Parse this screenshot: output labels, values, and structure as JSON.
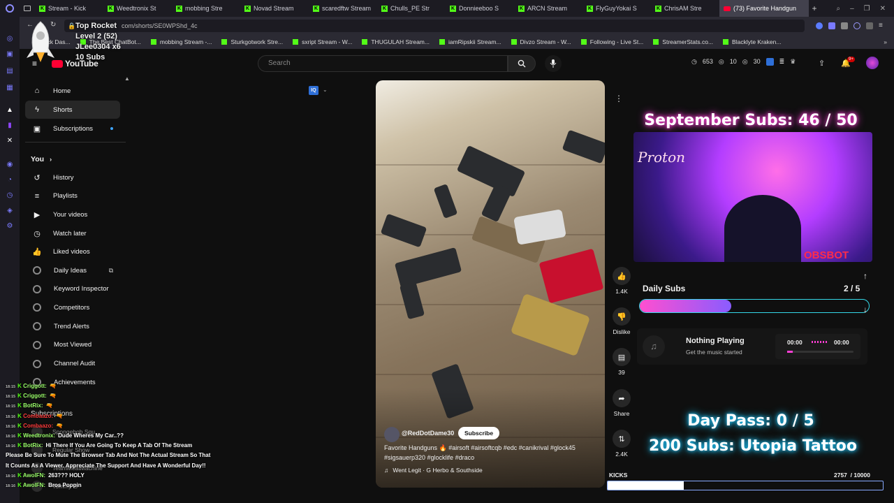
{
  "tabs": [
    {
      "label": "Stream - Kick",
      "kind": "kick"
    },
    {
      "label": "Weedtronix St",
      "kind": "kick"
    },
    {
      "label": "mobbing Stre",
      "kind": "kick"
    },
    {
      "label": "Novad Stream",
      "kind": "kick"
    },
    {
      "label": "scaredftw Stream",
      "kind": "kick"
    },
    {
      "label": "Chulls_PE Str",
      "kind": "kick"
    },
    {
      "label": "Donnieeboo S",
      "kind": "kick"
    },
    {
      "label": "ARCN Stream",
      "kind": "kick"
    },
    {
      "label": "FlyGuyYokai S",
      "kind": "kick"
    },
    {
      "label": "ChrisAM Stre",
      "kind": "kick"
    },
    {
      "label": "(73) Favorite Handgun",
      "kind": "youtube"
    }
  ],
  "address": {
    "url": "com/shorts/SE0WPShd_4c"
  },
  "bookmarks": [
    "Kick Das...",
    "The Best ChatBot...",
    "mobbing Stream -...",
    "Sturkgotwork Stre...",
    "sxript Stream - W...",
    "THUGULAH Stream...",
    "iamRipskii Stream...",
    "Divzo Stream - W...",
    "Following - Live St...",
    "StreamerStats.co...",
    "Blacklyte Kraken..."
  ],
  "rocket_overlay": {
    "title": "Top Rocket",
    "level": "Level 2 (52)",
    "user": "JLee0304 x6",
    "subs": "10 Subs"
  },
  "youtube": {
    "logo": "YouTube",
    "search_placeholder": "Search"
  },
  "sidebar": {
    "main": [
      {
        "label": "Home",
        "icon": "home-icon"
      },
      {
        "label": "Shorts",
        "icon": "shorts-icon"
      },
      {
        "label": "Subscriptions",
        "icon": "subscriptions-icon"
      }
    ],
    "you_label": "You",
    "you": [
      {
        "label": "History",
        "icon": "history-icon"
      },
      {
        "label": "Playlists",
        "icon": "playlists-icon"
      },
      {
        "label": "Your videos",
        "icon": "your-videos-icon"
      },
      {
        "label": "Watch later",
        "icon": "watch-later-icon"
      },
      {
        "label": "Liked videos",
        "icon": "liked-videos-icon"
      }
    ],
    "extensions": [
      "Daily Ideas",
      "Keyword Inspector",
      "Competitors",
      "Trend Alerts",
      "Most Viewed",
      "Channel Audit",
      "Achievements"
    ],
    "subscriptions_label": "Subscriptions",
    "subscriptions": [
      "Spongebob Squ...",
      "Regular Show",
      "TeamMeatMachine",
      "Tommy G"
    ]
  },
  "header_stats": {
    "views": "653",
    "likes": "10",
    "comments": "30"
  },
  "video": {
    "channel": "@RedDotDame30",
    "subscribe": "Subscribe",
    "caption_line1": "Favorite Handguns 🔥 #airsoft #airsoftcqb #edc #canikrival #glock45",
    "caption_line2": "#sigsauerp320 #glocklife #draco",
    "music": "Went Legit · G Herbo & Southside"
  },
  "actions": {
    "likes": "1.4K",
    "dislike": "Dislike",
    "comments": "39",
    "share": "Share",
    "remix": "2.4K"
  },
  "overlay": {
    "sept_subs": "September Subs: 46 / 50",
    "cam_logo": "OBSBOT",
    "cam_name": "Proton",
    "daily_subs_label": "Daily Subs",
    "daily_subs_value": "2 / 5",
    "daily_subs_progress": 0.4,
    "music_title": "Nothing Playing",
    "music_sub": "Get the music started",
    "music_time_start": "00:00",
    "music_time_end": "00:00",
    "day_pass": "Day Pass: 0 / 5",
    "subs_goal": "200 Subs: Utopia Tattoo",
    "kicks_label": "KICKS",
    "kicks_value": "2757  / 10000",
    "kicks_progress": 0.2757
  },
  "chat": [
    {
      "time": "18:15",
      "user": "Criggott:",
      "msg": "🔫"
    },
    {
      "time": "18:15",
      "user": "Criggott:",
      "msg": "🔫"
    },
    {
      "time": "18:15",
      "user": "BotRix:",
      "msg": "🔫"
    },
    {
      "time": "18:16",
      "user": "Combaazo:",
      "msg": "🔫"
    },
    {
      "time": "18:16",
      "user": "Combaazo:",
      "msg": "🔫"
    },
    {
      "time": "18:16",
      "user": "Weedtronix:",
      "msg": "Dude Wheres My Car..??"
    },
    {
      "time": "18:16",
      "user": "BotRix:",
      "msg": "Hi There If You Are Going To Keep A Tab Of The Stream"
    },
    {
      "time": "",
      "user": "",
      "msg": "Please Be Sure To Mute The Browser Tab And Not The Actual Stream So That"
    },
    {
      "time": "",
      "user": "",
      "msg": "It Counts As A Viewer. Appreciate The Support And Have A Wonderful Day!!"
    },
    {
      "time": "18:16",
      "user": "AwolFN:",
      "msg": "263??? HOLY"
    },
    {
      "time": "18:16",
      "user": "AwolFN:",
      "msg": "Bros Poppin"
    }
  ],
  "colors": {
    "bg": "#0f0f0f",
    "kick_green": "#53fc18",
    "yt_red": "#ff0033",
    "neon_pink": "#ff3fd6",
    "neon_blue": "#1ec8ff"
  }
}
